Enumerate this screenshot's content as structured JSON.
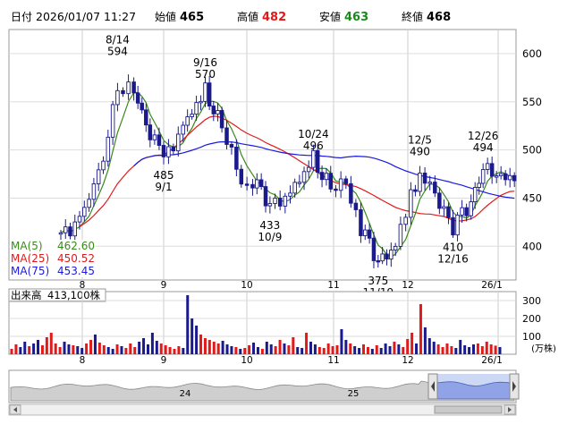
{
  "header": {
    "label_date": "日付",
    "datetime": "2026/01/07 11:27",
    "label_open": "始値",
    "open": "465",
    "label_high": "高値",
    "high": "482",
    "label_low": "安値",
    "low": "463",
    "label_close": "終値",
    "close": "468"
  },
  "colors": {
    "up_candle": "#ffffff",
    "down_candle": "#1a1a8c",
    "ma5": "#3a8a1a",
    "ma25": "#e01a1a",
    "ma75": "#1a1ae0",
    "volume_up": "#e01a1a",
    "volume_down": "#1a1a8c",
    "header_high": "#e01a1a",
    "header_low": "#1a8a1a"
  },
  "legend": [
    {
      "name": "MA(5)",
      "value": "462.60",
      "color": "#3a8a1a"
    },
    {
      "name": "MA(25)",
      "value": "450.52",
      "color": "#e01a1a"
    },
    {
      "name": "MA(75)",
      "value": "453.45",
      "color": "#1a1ae0"
    }
  ],
  "volume_header": {
    "label": "出来高",
    "value": "413,100株"
  },
  "volume_unit": "(万株)",
  "navigator": {
    "labels": [
      "24",
      "25"
    ]
  },
  "chart_data": [
    {
      "type": "candlestick",
      "title": "",
      "x_tick_labels": [
        "8",
        "9",
        "10",
        "11",
        "12",
        "26/1"
      ],
      "y_ticks": [
        400,
        450,
        500,
        550,
        600
      ],
      "ylim": [
        365,
        625
      ],
      "grid": true,
      "annotations": [
        {
          "date": "8/14",
          "value": 594,
          "text_top": "8/14",
          "text_bottom": "594",
          "position": "above"
        },
        {
          "date": "9/1",
          "value": 485,
          "text_top": "485",
          "text_bottom": "9/1",
          "position": "below"
        },
        {
          "date": "9/16",
          "value": 570,
          "text_top": "9/16",
          "text_bottom": "570",
          "position": "above"
        },
        {
          "date": "10/9",
          "value": 433,
          "text_top": "433",
          "text_bottom": "10/9",
          "position": "below"
        },
        {
          "date": "10/24",
          "value": 496,
          "text_top": "10/24",
          "text_bottom": "496",
          "position": "above"
        },
        {
          "date": "11/19",
          "value": 375,
          "text_top": "375",
          "text_bottom": "11/19",
          "position": "below"
        },
        {
          "date": "12/5",
          "value": 490,
          "text_top": "12/5",
          "text_bottom": "490",
          "position": "above"
        },
        {
          "date": "12/16",
          "value": 410,
          "text_top": "410",
          "text_bottom": "12/16",
          "position": "below"
        },
        {
          "date": "12/26",
          "value": 494,
          "text_top": "12/26",
          "text_bottom": "494",
          "position": "above"
        }
      ],
      "series_close": [
        {
          "date": "7/24",
          "close": 410
        },
        {
          "date": "7/31",
          "close": 430
        },
        {
          "date": "8/7",
          "close": 470
        },
        {
          "date": "8/14",
          "close": 565
        },
        {
          "date": "8/20",
          "close": 560
        },
        {
          "date": "8/26",
          "close": 520
        },
        {
          "date": "9/1",
          "close": 490
        },
        {
          "date": "9/8",
          "close": 525
        },
        {
          "date": "9/16",
          "close": 560
        },
        {
          "date": "9/22",
          "close": 525
        },
        {
          "date": "9/29",
          "close": 465
        },
        {
          "date": "10/3",
          "close": 470
        },
        {
          "date": "10/9",
          "close": 443
        },
        {
          "date": "10/16",
          "close": 455
        },
        {
          "date": "10/24",
          "close": 490
        },
        {
          "date": "10/30",
          "close": 460
        },
        {
          "date": "11/6",
          "close": 465
        },
        {
          "date": "11/12",
          "close": 420
        },
        {
          "date": "11/19",
          "close": 385
        },
        {
          "date": "11/26",
          "close": 400
        },
        {
          "date": "12/2",
          "close": 450
        },
        {
          "date": "12/5",
          "close": 475
        },
        {
          "date": "12/10",
          "close": 455
        },
        {
          "date": "12/16",
          "close": 420
        },
        {
          "date": "12/22",
          "close": 448
        },
        {
          "date": "12/26",
          "close": 480
        },
        {
          "date": "1/7",
          "close": 468
        }
      ],
      "moving_averages": [
        {
          "name": "MA(5)",
          "value": 462.6
        },
        {
          "name": "MA(25)",
          "value": 450.52
        },
        {
          "name": "MA(75)",
          "value": 453.45
        }
      ]
    },
    {
      "type": "bar",
      "title": "出来高",
      "y_ticks": [
        100,
        200,
        300
      ],
      "ylim": [
        0,
        350
      ],
      "x_tick_labels": [
        "8",
        "9",
        "10",
        "11",
        "12",
        "26/1"
      ],
      "unit": "(万株)",
      "values": [
        30,
        55,
        40,
        70,
        45,
        60,
        80,
        50,
        95,
        120,
        60,
        40,
        70,
        55,
        50,
        45,
        35,
        60,
        80,
        110,
        65,
        50,
        40,
        30,
        55,
        45,
        35,
        60,
        40,
        70,
        90,
        55,
        120,
        75,
        60,
        50,
        40,
        30,
        45,
        35,
        330,
        200,
        160,
        110,
        90,
        80,
        70,
        60,
        75,
        55,
        45,
        40,
        30,
        35,
        50,
        65,
        40,
        30,
        70,
        55,
        45,
        80,
        60,
        50,
        95,
        40,
        35,
        120,
        70,
        55,
        40,
        35,
        60,
        45,
        50,
        140,
        80,
        60,
        45,
        35,
        55,
        40,
        30,
        50,
        35,
        60,
        45,
        70,
        55,
        40,
        85,
        120,
        60,
        280,
        150,
        90,
        70,
        55,
        40,
        60,
        45,
        35,
        80,
        50,
        40,
        55,
        60,
        45,
        70,
        55,
        48,
        40
      ]
    }
  ]
}
